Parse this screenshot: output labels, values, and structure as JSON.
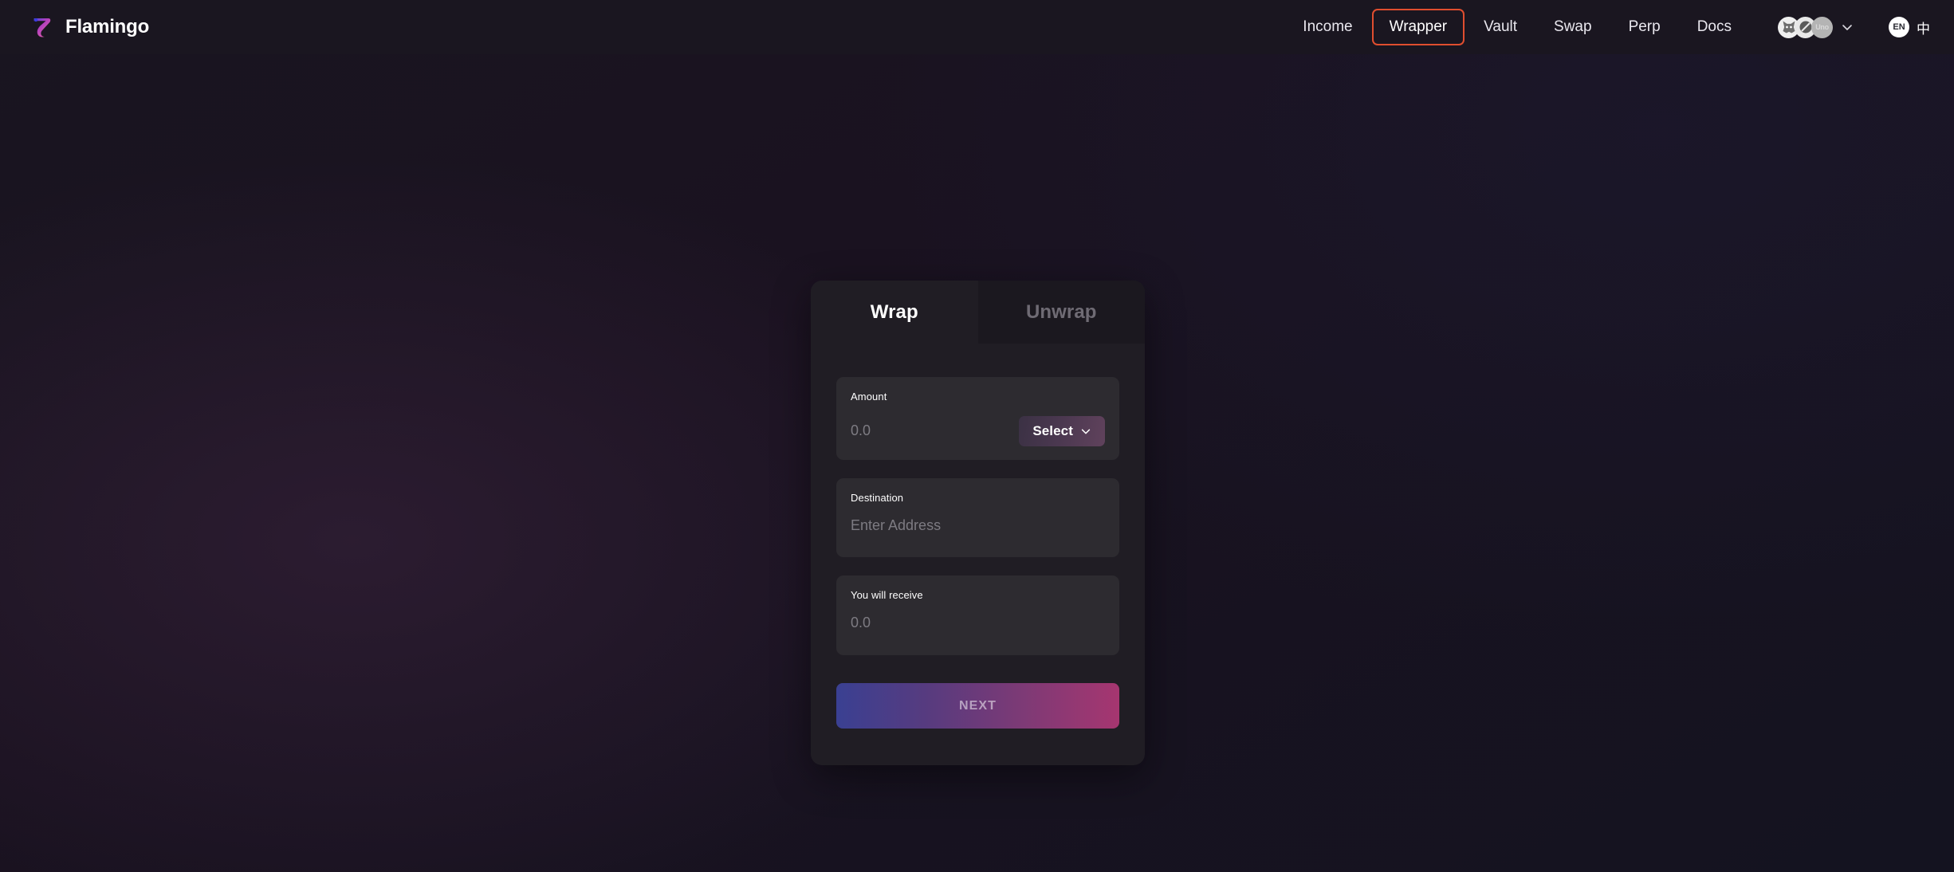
{
  "header": {
    "brand": {
      "name": "Flamingo",
      "logo_icon": "flamingo-logo-icon"
    },
    "nav_items": [
      {
        "label": "Income",
        "highlighted": false
      },
      {
        "label": "Wrapper",
        "highlighted": true
      },
      {
        "label": "Vault",
        "highlighted": false
      },
      {
        "label": "Swap",
        "highlighted": false
      },
      {
        "label": "Perp",
        "highlighted": false
      },
      {
        "label": "Docs",
        "highlighted": false
      }
    ],
    "wallets": {
      "items": [
        {
          "name": "metamask-wallet-icon",
          "label": ""
        },
        {
          "name": "neoline-wallet-icon",
          "label": ""
        },
        {
          "name": "uno-wallet-icon",
          "label": "Uno"
        }
      ],
      "chevron_icon": "chevron-down-icon"
    },
    "language": {
      "english_label": "EN",
      "chinese_label": "中"
    },
    "highlight_color": "#e04e2f"
  },
  "card": {
    "tabs": [
      {
        "label": "Wrap",
        "active": true
      },
      {
        "label": "Unwrap",
        "active": false
      }
    ],
    "amount": {
      "label": "Amount",
      "placeholder": "0.0",
      "value": "",
      "select_label": "Select",
      "select_chevron_icon": "chevron-down-icon"
    },
    "destination": {
      "label": "Destination",
      "placeholder": "Enter Address",
      "value": ""
    },
    "receive": {
      "label": "You will receive",
      "placeholder": "0.0",
      "value": ""
    },
    "next_button": {
      "label": "NEXT",
      "gradient_start": "#3a4092",
      "gradient_end": "#a63670"
    }
  }
}
